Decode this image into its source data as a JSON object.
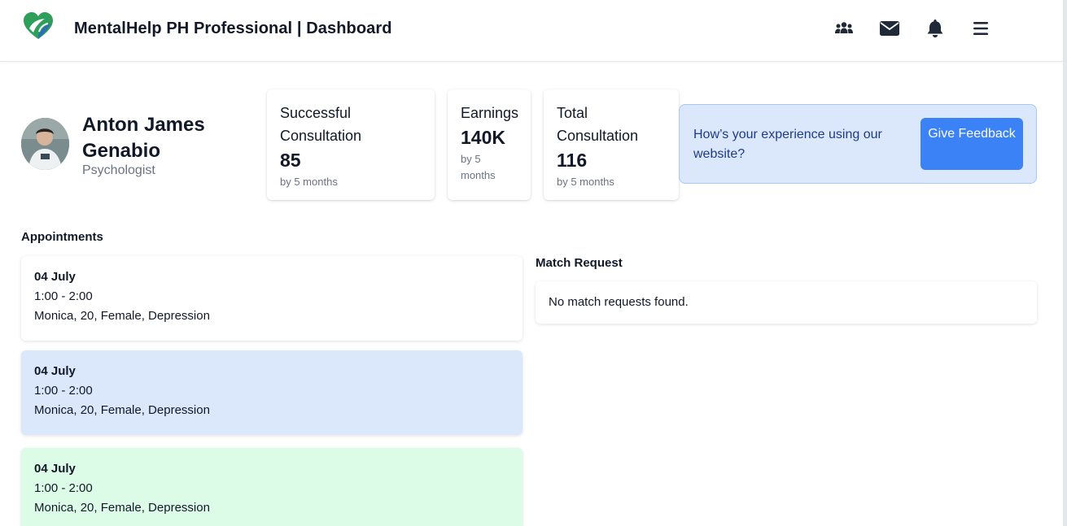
{
  "header": {
    "title": "MentalHelp PH Professional | Dashboard",
    "icons": [
      "users-icon",
      "envelope-icon",
      "bell-icon",
      "menu-icon"
    ]
  },
  "profile": {
    "name": "Anton James Genabio",
    "role": "Psychologist"
  },
  "stats": [
    {
      "label": "Successful Consultation",
      "value": "85",
      "sub": "by 5 months"
    },
    {
      "label": "Earnings",
      "value": "140K",
      "sub": "by 5 months"
    },
    {
      "label": "Total Consultation",
      "value": "116",
      "sub": "by 5 months"
    }
  ],
  "feedback": {
    "prompt": "How’s your experience using our website?",
    "button_label": "Give Feedback"
  },
  "appointments": {
    "title": "Appointments",
    "items": [
      {
        "date": "04 July",
        "time": "1:00 - 2:00",
        "details": "Monica, 20, Female, Depression",
        "color": "#ffffff"
      },
      {
        "date": "04 July",
        "time": "1:00 - 2:00",
        "details": "Monica, 20, Female, Depression",
        "color": "#dbe8fb"
      },
      {
        "date": "04 July",
        "time": "1:00 - 2:00",
        "details": "Monica, 20, Female, Depression",
        "color": "#dcfce7"
      }
    ]
  },
  "match_request": {
    "title": "Match Request",
    "empty_text": "No match requests found."
  },
  "colors": {
    "accent": "#3b82f6",
    "feedback_bg": "#dbe8fb",
    "logo_green": "#2e9e5b",
    "logo_blue": "#2f6fb5"
  }
}
